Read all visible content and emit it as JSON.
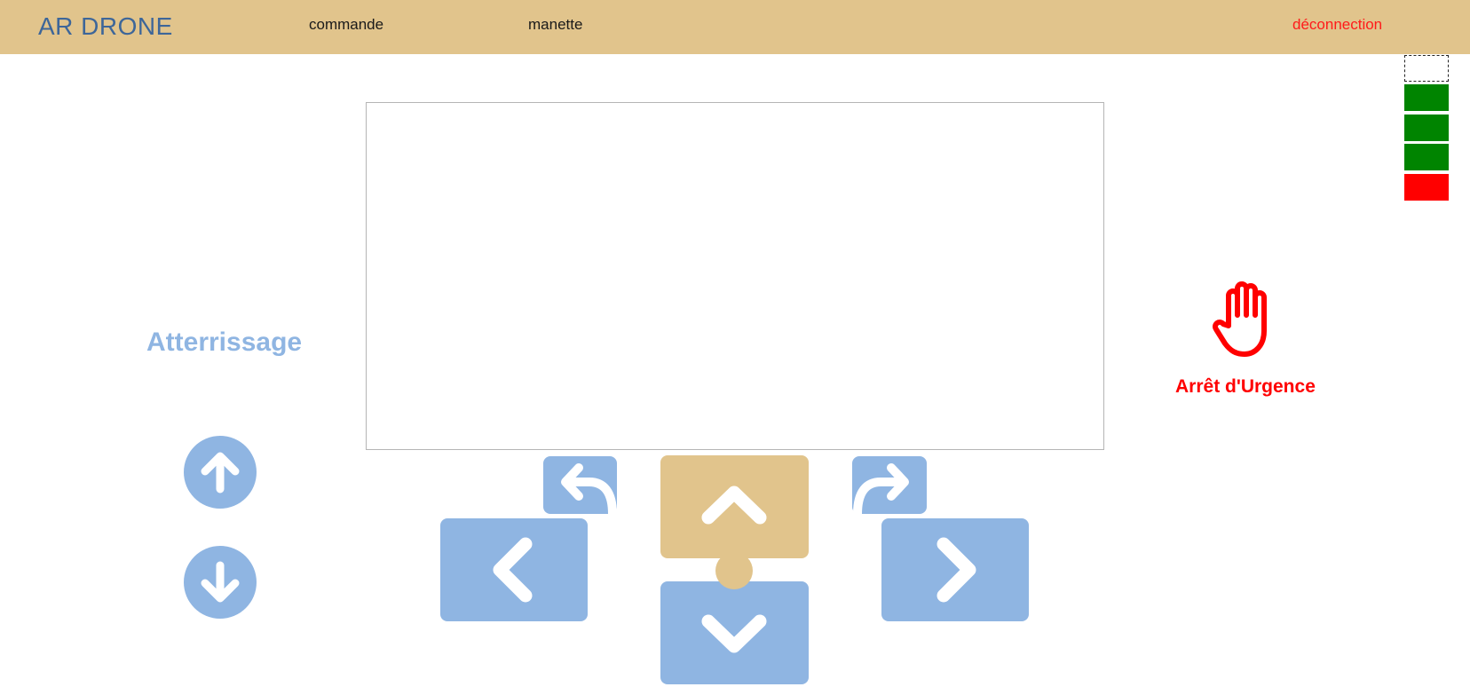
{
  "navbar": {
    "brand": "AR DRONE",
    "links": {
      "commande": "commande",
      "manette": "manette",
      "logout": "déconnection"
    }
  },
  "battery": {
    "levels": [
      "empty",
      "green",
      "green",
      "green",
      "red"
    ],
    "colors": {
      "green": "#008400",
      "red": "#ff0000"
    }
  },
  "controls": {
    "landing_label": "Atterrissage",
    "emergency_label": "Arrêt d'Urgence",
    "icons": {
      "altitude_up": "arrow-up-circle-icon",
      "altitude_down": "arrow-down-circle-icon",
      "rotate_left": "rotate-left-icon",
      "rotate_right": "rotate-right-icon",
      "forward": "chevron-up-icon",
      "left": "chevron-left-icon",
      "right": "chevron-right-icon",
      "back": "chevron-down-icon",
      "emergency": "hand-stop-icon"
    }
  },
  "colors": {
    "accent_blue": "#8fb5e2",
    "accent_tan": "#e1c48c",
    "danger": "#ff0000",
    "brand_text": "#3d6699"
  }
}
